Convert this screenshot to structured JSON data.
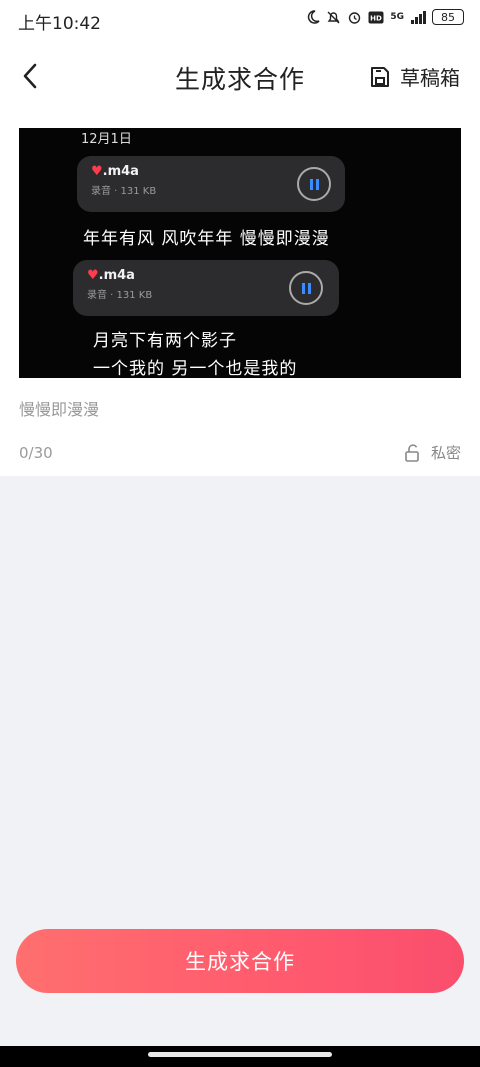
{
  "status_bar": {
    "time": "上午10:42",
    "network": "5G",
    "battery": "85"
  },
  "nav": {
    "title": "生成求合作",
    "drafts_label": "草稿箱"
  },
  "media": {
    "date": "12月1日",
    "bubbles": [
      {
        "name": ".m4a",
        "meta": "录音 · 131 KB"
      },
      {
        "name": ".m4a",
        "meta": "录音 · 131 KB"
      }
    ],
    "lyrics": [
      "年年有风 风吹年年   慢慢即漫漫",
      "月亮下有两个影子",
      "一个我的 另一个也是我的"
    ]
  },
  "caption": "慢慢即漫漫",
  "counter": "0/30",
  "privacy_label": "私密",
  "cta_label": "生成求合作",
  "colors": {
    "accent_start": "#ff6f6f",
    "accent_end": "#fa4e6d",
    "page_bg": "#f0f2f5"
  }
}
